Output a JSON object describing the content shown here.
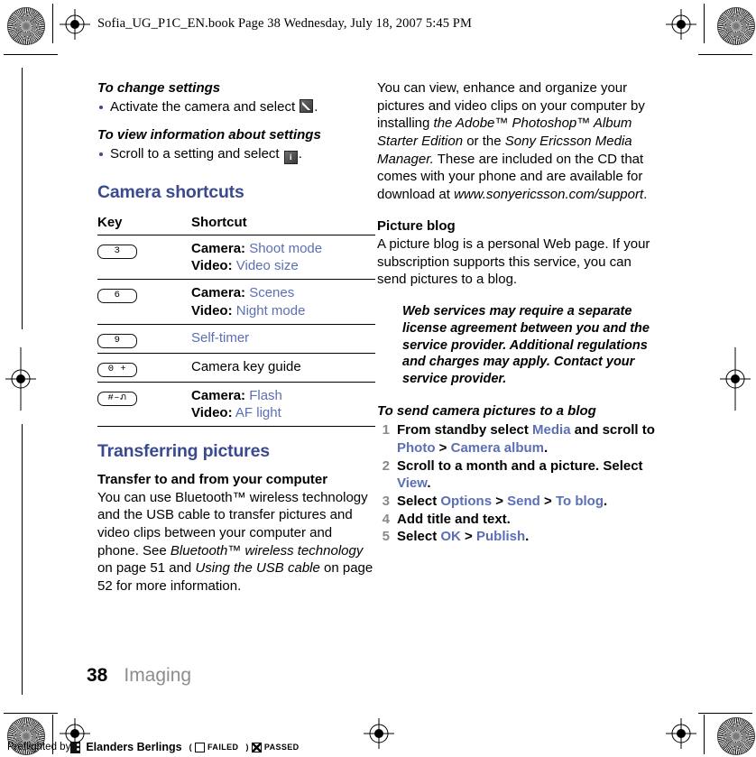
{
  "header": {
    "slug": "Sofia_UG_P1C_EN.book  Page 38  Wednesday, July 18, 2007  5:45 PM"
  },
  "left_column": {
    "change_settings_heading": "To change settings",
    "change_settings_bullet_pre": "Activate the camera and select ",
    "change_settings_bullet_post": ".",
    "view_info_heading": "To view information about settings",
    "view_info_bullet_pre": "Scroll to a setting and select ",
    "view_info_bullet_post": ".",
    "camera_shortcuts_heading": "Camera shortcuts",
    "table": {
      "headers": [
        "Key",
        "Shortcut"
      ],
      "rows": [
        {
          "key": "3",
          "lines": [
            {
              "label": "Camera:",
              "value": "Shoot mode"
            },
            {
              "label": "Video:",
              "value": "Video size"
            }
          ]
        },
        {
          "key": "6",
          "lines": [
            {
              "label": "Camera:",
              "value": "Scenes"
            },
            {
              "label": "Video:",
              "value": "Night mode"
            }
          ]
        },
        {
          "key": "9",
          "lines": [
            {
              "label": "",
              "value": "Self-timer"
            }
          ]
        },
        {
          "key": "0 +",
          "lines": [
            {
              "label": "Camera key guide",
              "value": ""
            }
          ]
        },
        {
          "key": "#–ภ",
          "lines": [
            {
              "label": "Camera:",
              "value": "Flash"
            },
            {
              "label": "Video:",
              "value": "AF light"
            }
          ]
        }
      ]
    },
    "transferring_heading": "Transferring pictures",
    "transfer_sub_heading": "Transfer to and from your computer",
    "transfer_body_1": "You can use Bluetooth™ wireless technology and the USB cable to transfer pictures and video clips between your computer and phone. See ",
    "transfer_body_italic_1": "Bluetooth™ wireless technology",
    "transfer_body_2": " on page 51 and ",
    "transfer_body_italic_2": "Using the USB cable",
    "transfer_body_3": " on page 52 for more information."
  },
  "right_column": {
    "intro_1": "You can view, enhance and organize your pictures and video clips on your computer by installing ",
    "intro_italic_1": "the Adobe™ Photoshop™ Album Starter Edition",
    "intro_2": " or the ",
    "intro_italic_2": "Sony Ericsson Media Manager.",
    "intro_3": " These are included on the CD that comes with your phone and are available for download at ",
    "intro_italic_3": "www.sonyericsson.com/support",
    "intro_4": ".",
    "picture_blog_heading": "Picture blog",
    "picture_blog_body": "A picture blog is a personal Web page. If your subscription supports this service, you can send pictures to a blog.",
    "note": "Web services may require a separate license agreement between you and the service provider. Additional regulations and charges may apply. Contact your service provider.",
    "send_blog_heading": "To send camera pictures to a blog",
    "steps": [
      {
        "num": "1",
        "parts": [
          {
            "t": "From standby select ",
            "s": "plain"
          },
          {
            "t": "Media",
            "s": "link"
          },
          {
            "t": " and scroll to ",
            "s": "plain"
          },
          {
            "t": "Photo",
            "s": "link"
          },
          {
            "t": " > ",
            "s": "plain"
          },
          {
            "t": "Camera album",
            "s": "link"
          },
          {
            "t": ".",
            "s": "plain"
          }
        ]
      },
      {
        "num": "2",
        "parts": [
          {
            "t": "Scroll to a month and a picture. Select ",
            "s": "plain"
          },
          {
            "t": "View",
            "s": "link"
          },
          {
            "t": ".",
            "s": "plain"
          }
        ]
      },
      {
        "num": "3",
        "parts": [
          {
            "t": "Select ",
            "s": "plain"
          },
          {
            "t": "Options",
            "s": "link"
          },
          {
            "t": " > ",
            "s": "plain"
          },
          {
            "t": "Send",
            "s": "link"
          },
          {
            "t": " > ",
            "s": "plain"
          },
          {
            "t": "To blog",
            "s": "link"
          },
          {
            "t": ".",
            "s": "plain"
          }
        ]
      },
      {
        "num": "4",
        "parts": [
          {
            "t": "Add title and text.",
            "s": "plain"
          }
        ]
      },
      {
        "num": "5",
        "parts": [
          {
            "t": "Select ",
            "s": "plain"
          },
          {
            "t": "OK",
            "s": "link"
          },
          {
            "t": " > ",
            "s": "plain"
          },
          {
            "t": "Publish",
            "s": "link"
          },
          {
            "t": ".",
            "s": "plain"
          }
        ]
      }
    ]
  },
  "footer": {
    "page_number": "38",
    "chapter": "Imaging"
  },
  "preflight": {
    "text": "Preflighted by",
    "brand": "Elanders Berlings",
    "open_paren": "(",
    "failed_label": "FAILED",
    "close_paren": ")",
    "passed_label": "PASSED"
  },
  "icons": {
    "settings": "wrench-settings-icon",
    "info": "i",
    "note": "exclamation-icon"
  },
  "colors": {
    "heading_blue": "#3b4a8e",
    "link_blue": "#5b6fb5",
    "chapter_gray": "#8d8d8d",
    "step_num_gray": "#8a8a8a"
  }
}
